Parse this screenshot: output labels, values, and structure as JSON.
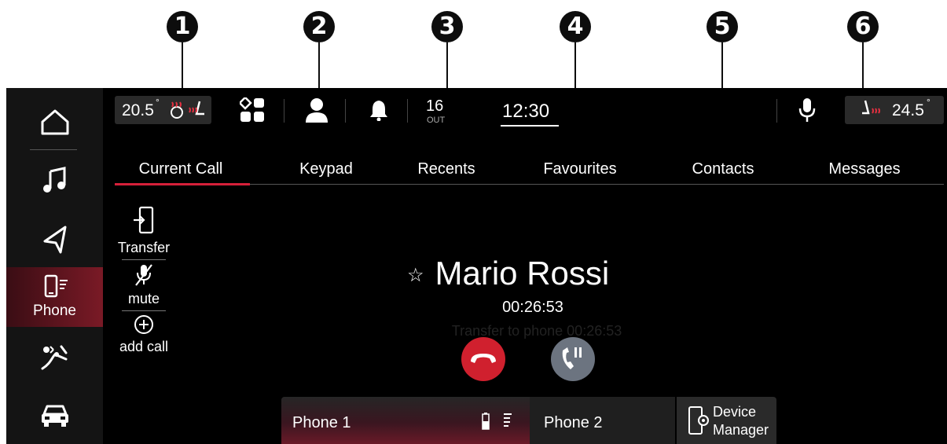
{
  "callouts": [
    "1",
    "2",
    "3",
    "4",
    "5",
    "6"
  ],
  "topbar": {
    "left_temp": "20.5",
    "left_temp_deg": "°",
    "outside_temp": "16",
    "outside_label": "OUT",
    "clock": "12:30",
    "right_temp": "24.5",
    "right_temp_deg": "°"
  },
  "rail": {
    "items": [
      "home-icon",
      "music-note-icon",
      "navigation-arrow-icon",
      "phone-icon",
      "climate-fan-icon",
      "car-icon"
    ],
    "phone_label": "Phone"
  },
  "tabs": [
    "Current Call",
    "Keypad",
    "Recents",
    "Favourites",
    "Contacts",
    "Messages"
  ],
  "active_tab": "Current Call",
  "side_actions": {
    "transfer": "Transfer",
    "mute": "mute",
    "add_call": "add call"
  },
  "call": {
    "caller_name": "Mario Rossi",
    "duration": "00:26:53",
    "transfer_ghost": "Transfer to phone 00:26:53"
  },
  "bottom": {
    "phone1": "Phone 1",
    "phone2": "Phone 2",
    "device_manager_line1": "Device",
    "device_manager_line2": "Manager"
  },
  "colors": {
    "accent_red": "#d6203a",
    "hangup_red": "#d0202e",
    "hold_gray": "#6c7480"
  }
}
